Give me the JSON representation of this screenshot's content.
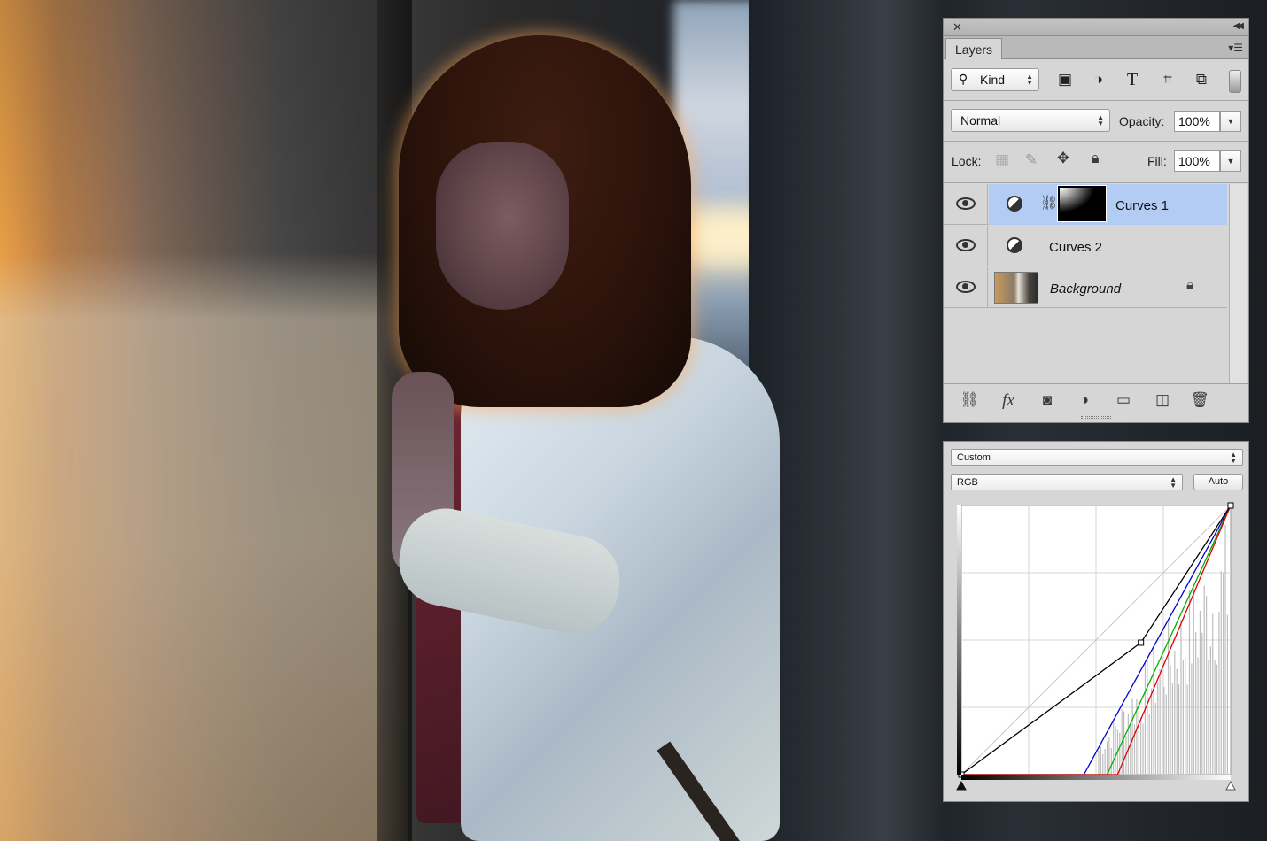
{
  "layers_panel": {
    "tab_label": "Layers",
    "filter": {
      "kind_label": "Kind",
      "filter_icons": [
        "image-filter-icon",
        "adjustment-filter-icon",
        "type-filter-icon",
        "shape-filter-icon",
        "smart-object-filter-icon"
      ]
    },
    "blend_mode": "Normal",
    "opacity_label": "Opacity:",
    "opacity_value": "100%",
    "lock_label": "Lock:",
    "fill_label": "Fill:",
    "fill_value": "100%",
    "layers": [
      {
        "name": "Curves 1",
        "type": "adjustment",
        "selected": true,
        "has_mask": true
      },
      {
        "name": "Curves 2",
        "type": "adjustment",
        "selected": false,
        "has_mask": false
      },
      {
        "name": "Background",
        "type": "background",
        "selected": false,
        "locked": true
      }
    ],
    "footer_icons": [
      "link-layers-icon",
      "fx-icon",
      "add-mask-icon",
      "new-adjustment-icon",
      "new-group-icon",
      "new-layer-icon",
      "trash-icon"
    ],
    "fx_label": "fx"
  },
  "curves_panel": {
    "preset": "Custom",
    "channel": "RGB",
    "auto_label": "Auto",
    "colors": {
      "rgb": "#000000",
      "red": "#e00000",
      "green": "#00b000",
      "blue": "#0000d0",
      "histogram": "#bdbdbd"
    },
    "curves": {
      "rgb": [
        [
          0,
          0
        ],
        [
          170,
          125
        ],
        [
          255,
          255
        ]
      ],
      "red": [
        [
          0,
          0
        ],
        [
          148,
          0
        ],
        [
          255,
          255
        ]
      ],
      "green": [
        [
          0,
          0
        ],
        [
          138,
          0
        ],
        [
          255,
          255
        ]
      ],
      "blue": [
        [
          0,
          0
        ],
        [
          116,
          0
        ],
        [
          255,
          255
        ]
      ]
    },
    "reference_line": [
      [
        0,
        0
      ],
      [
        255,
        255
      ]
    ]
  }
}
